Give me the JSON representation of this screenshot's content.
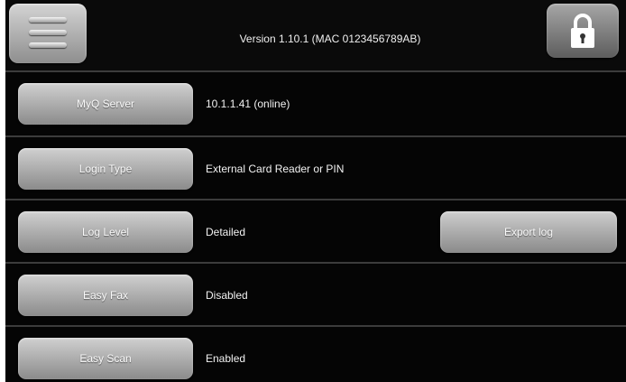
{
  "header": {
    "menu_icon": "hamburger-menu-icon",
    "version_text": "Version 1.10.1 (MAC 0123456789AB)",
    "lock_icon": "padlock-icon"
  },
  "settings": [
    {
      "button_label": "MyQ Server",
      "value": "10.1.1.41 (online)"
    },
    {
      "button_label": "Login Type",
      "value": "External Card Reader or PIN"
    },
    {
      "button_label": "Log Level",
      "value": "Detailed",
      "extra_button_label": "Export log"
    },
    {
      "button_label": "Easy Fax",
      "value": "Disabled"
    },
    {
      "button_label": "Easy Scan",
      "value": "Enabled"
    }
  ],
  "colors": {
    "background": "#050505",
    "button": "#a8a8a8",
    "text": "#f2f2f2"
  }
}
